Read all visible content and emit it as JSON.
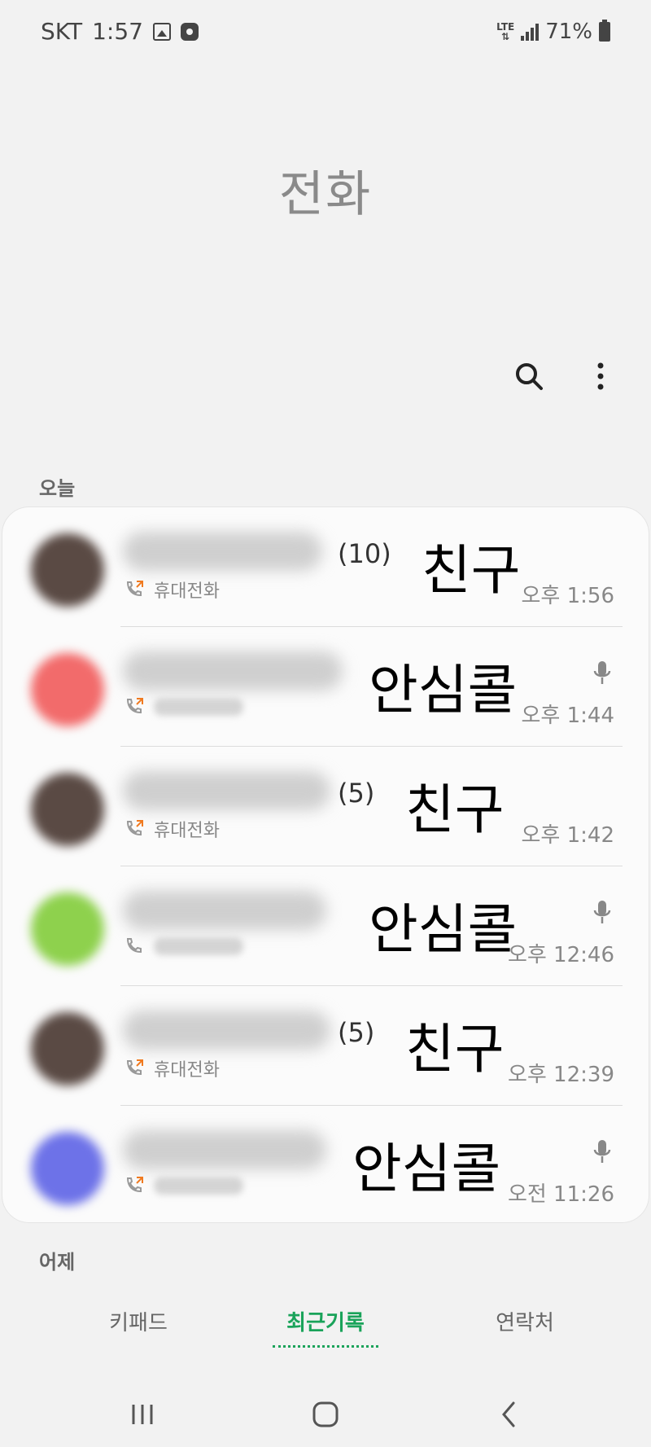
{
  "status_bar": {
    "carrier": "SKT",
    "time": "1:57",
    "network": "LTE",
    "battery": "71%"
  },
  "header": {
    "title": "전화"
  },
  "toolbar": {
    "search_icon": "search-icon",
    "more_icon": "more-vert-icon"
  },
  "sections": {
    "today": "오늘",
    "yesterday": "어제"
  },
  "calls": [
    {
      "count": "(10)",
      "overlay": "친구",
      "sub": "휴대전화",
      "time": "오후 1:56",
      "avatar_color": "#5a4a44",
      "hd": true,
      "mic": false
    },
    {
      "count": "",
      "overlay": "안심콜",
      "sub": "",
      "time": "오후 1:44",
      "avatar_color": "#f26b6b",
      "hd": false,
      "mic": true
    },
    {
      "count": "(5)",
      "overlay": "친구",
      "sub": "휴대전화",
      "time": "오후 1:42",
      "avatar_color": "#5a4a44",
      "hd": true,
      "mic": false
    },
    {
      "count": "",
      "overlay": "안심콜",
      "sub": "",
      "time": "오후 12:46",
      "avatar_color": "#8ed14d",
      "hd": false,
      "mic": true
    },
    {
      "count": "(5)",
      "overlay": "친구",
      "sub": "휴대전화",
      "time": "오후 12:39",
      "avatar_color": "#5a4a44",
      "hd": true,
      "mic": false
    },
    {
      "count": "",
      "overlay": "안심콜",
      "sub": "",
      "time": "오전 11:26",
      "avatar_color": "#6d72e8",
      "hd": false,
      "mic": true
    }
  ],
  "tabs": {
    "keypad": "키패드",
    "recents": "최근기록",
    "contacts": "연락처"
  },
  "colors": {
    "accent": "#1aa35a",
    "background": "#f2f2f2"
  }
}
